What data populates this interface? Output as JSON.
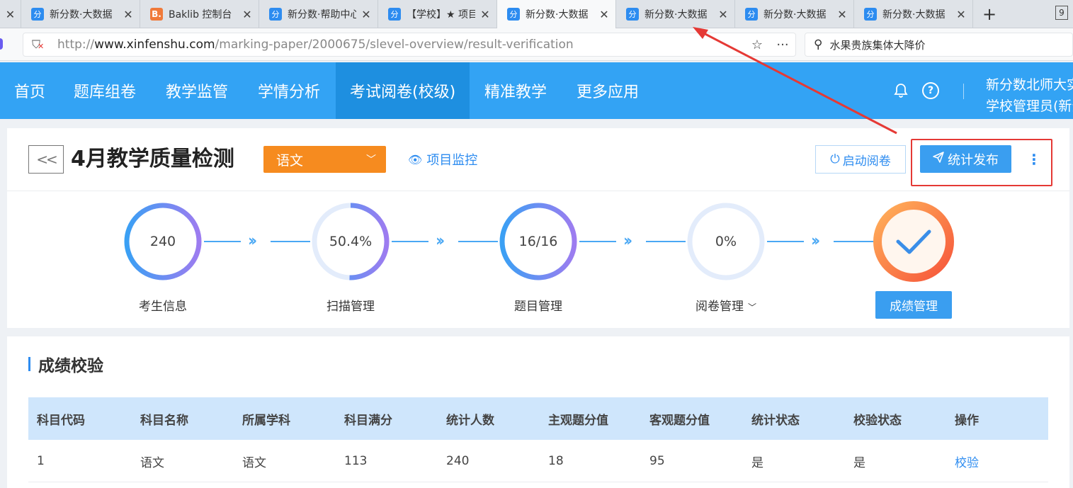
{
  "browser": {
    "tabs": [
      {
        "label": "新分数·大数据",
        "favicon": "分",
        "active": false
      },
      {
        "label": "Baklib 控制台",
        "favicon": "B.",
        "active": false
      },
      {
        "label": "新分数·帮助中心",
        "favicon": "分",
        "active": false
      },
      {
        "label": "【学校】★ 项目",
        "favicon": "分",
        "active": false
      },
      {
        "label": "新分数·大数据",
        "favicon": "分",
        "active": true
      },
      {
        "label": "新分数·大数据",
        "favicon": "分",
        "active": false
      },
      {
        "label": "新分数·大数据",
        "favicon": "分",
        "active": false
      },
      {
        "label": "新分数·大数据",
        "favicon": "分",
        "active": false
      }
    ],
    "tab_count": "9",
    "url_prefix": "http://",
    "url_host": "www.xinfenshu.com",
    "url_path": "/marking-paper/2000675/slevel-overview/result-verification",
    "search_text": "水果贵族集体大降价"
  },
  "nav": {
    "items": [
      "首页",
      "题库组卷",
      "教学监管",
      "学情分析",
      "考试阅卷(校级)",
      "精准教学",
      "更多应用"
    ],
    "active_index": 4,
    "user_line1": "新分数北师大实验",
    "user_line2": "学校管理员(新分数)"
  },
  "header": {
    "back_label": "<<",
    "title": "4月教学质量检测",
    "subject": "语文",
    "monitor_label": "项目监控",
    "start_label": "启动阅卷",
    "publish_label": "统计发布"
  },
  "steps": [
    {
      "value": "240",
      "label": "考生信息",
      "progress": 1.0
    },
    {
      "value": "50.4%",
      "label": "扫描管理",
      "progress": 0.504
    },
    {
      "value": "16/16",
      "label": "题目管理",
      "progress": 1.0
    },
    {
      "value": "0%",
      "label": "阅卷管理",
      "progress": 0.0
    },
    {
      "value": "",
      "label": "成绩管理",
      "progress": 1.0
    }
  ],
  "section": {
    "title": "成绩校验",
    "columns": [
      "科目代码",
      "科目名称",
      "所属学科",
      "科目满分",
      "统计人数",
      "主观题分值",
      "客观题分值",
      "统计状态",
      "校验状态",
      "操作"
    ],
    "rows": [
      [
        "1",
        "语文",
        "语文",
        "113",
        "240",
        "18",
        "95",
        "是",
        "是",
        "校验"
      ]
    ]
  },
  "colors": {
    "nav_bg": "#33a3f4",
    "primary": "#3a9ef0",
    "subject_orange": "#f68b1f",
    "annotation_red": "#e53935"
  }
}
